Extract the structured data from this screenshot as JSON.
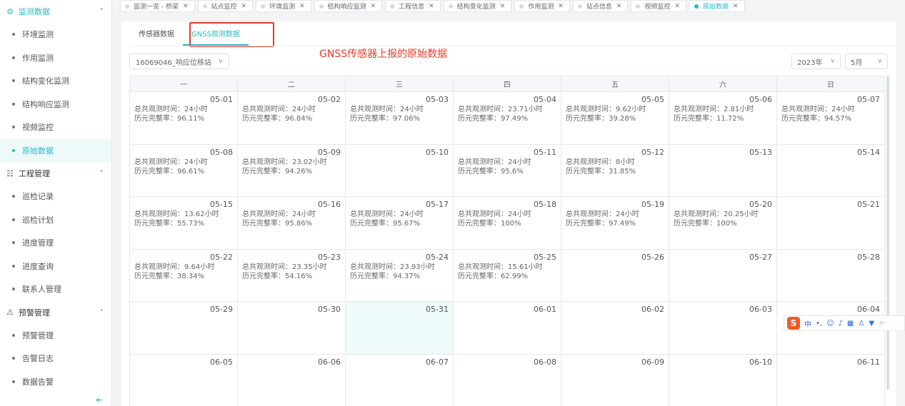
{
  "sidebar": {
    "groups": [
      {
        "title": "监测数据",
        "icon": "monitor-icon",
        "items": [
          "环境监测",
          "作用监测",
          "结构变化监测",
          "结构响应监测",
          "视频监控",
          "原始数据"
        ]
      },
      {
        "title": "工程管理",
        "icon": "project-icon",
        "items": [
          "巡检记录",
          "巡检计划",
          "进度管理",
          "进度查询",
          "联系人管理"
        ]
      },
      {
        "title": "预警管理",
        "icon": "alert-icon",
        "items": [
          "预警管理",
          "告警日志",
          "数据告警"
        ]
      }
    ],
    "active_item": "原始数据"
  },
  "tabs": [
    "监测一览 - 桥梁",
    "站点监控",
    "环境监测",
    "结构响应监测",
    "工程信息",
    "结构变化监测",
    "作用监测",
    "站点信息",
    "视频监控",
    "原始数据"
  ],
  "active_tab": "原始数据",
  "subtabs": [
    "传感器数据",
    "GNSS观测数据"
  ],
  "active_subtab": "GNSS观测数据",
  "station_select": "16069046_响应位移站",
  "annotation": "GNSS传感器上报的原始数据",
  "year_select": "2023年",
  "month_select": "5月",
  "weekdays": [
    "一",
    "二",
    "三",
    "四",
    "五",
    "六",
    "日"
  ],
  "labels": {
    "hours_prefix": "总共观测时间：",
    "ratio_prefix": "历元完整率："
  },
  "calendar": [
    [
      {
        "date": "05-01",
        "hours": "24小时",
        "ratio": "96.11%"
      },
      {
        "date": "05-02",
        "hours": "24小时",
        "ratio": "96.84%"
      },
      {
        "date": "05-03",
        "hours": "24小时",
        "ratio": "97.06%"
      },
      {
        "date": "05-04",
        "hours": "23.71小时",
        "ratio": "97.49%"
      },
      {
        "date": "05-05",
        "hours": "9.62小时",
        "ratio": "39.28%"
      },
      {
        "date": "05-06",
        "hours": "2.81小时",
        "ratio": "11.72%"
      },
      {
        "date": "05-07",
        "hours": "24小时",
        "ratio": "94.57%"
      }
    ],
    [
      {
        "date": "05-08",
        "hours": "24小时",
        "ratio": "96.61%"
      },
      {
        "date": "05-09",
        "hours": "23.02小时",
        "ratio": "94.26%"
      },
      {
        "date": "05-10"
      },
      {
        "date": "05-11",
        "hours": "24小时",
        "ratio": "95.6%"
      },
      {
        "date": "05-12",
        "hours": "8小时",
        "ratio": "31.85%"
      },
      {
        "date": "05-13"
      },
      {
        "date": "05-14"
      }
    ],
    [
      {
        "date": "05-15",
        "hours": "13.62小时",
        "ratio": "55.73%"
      },
      {
        "date": "05-16",
        "hours": "24小时",
        "ratio": "95.86%"
      },
      {
        "date": "05-17",
        "hours": "24小时",
        "ratio": "95.67%"
      },
      {
        "date": "05-18",
        "hours": "24小时",
        "ratio": "100%"
      },
      {
        "date": "05-19",
        "hours": "24小时",
        "ratio": "97.49%"
      },
      {
        "date": "05-20",
        "hours": "20.25小时",
        "ratio": "100%"
      },
      {
        "date": "05-21"
      }
    ],
    [
      {
        "date": "05-22",
        "hours": "9.64小时",
        "ratio": "38.34%"
      },
      {
        "date": "05-23",
        "hours": "23.35小时",
        "ratio": "54.16%"
      },
      {
        "date": "05-24",
        "hours": "23.93小时",
        "ratio": "94.37%"
      },
      {
        "date": "05-25",
        "hours": "15.61小时",
        "ratio": "62.99%"
      },
      {
        "date": "05-26"
      },
      {
        "date": "05-27"
      },
      {
        "date": "05-28"
      }
    ],
    [
      {
        "date": "05-29"
      },
      {
        "date": "05-30"
      },
      {
        "date": "05-31",
        "selected": true
      },
      {
        "date": "06-01"
      },
      {
        "date": "06-02"
      },
      {
        "date": "06-03"
      },
      {
        "date": "06-04"
      }
    ],
    [
      {
        "date": "06-05"
      },
      {
        "date": "06-06"
      },
      {
        "date": "06-07"
      },
      {
        "date": "06-08"
      },
      {
        "date": "06-09"
      },
      {
        "date": "06-10"
      },
      {
        "date": "06-11"
      }
    ]
  ],
  "ime": {
    "logo": "S",
    "mode": "中"
  },
  "colors": {
    "accent": "#2bb8c4",
    "annotation": "#e03b2c",
    "selected_cell": "#eefbfa"
  }
}
